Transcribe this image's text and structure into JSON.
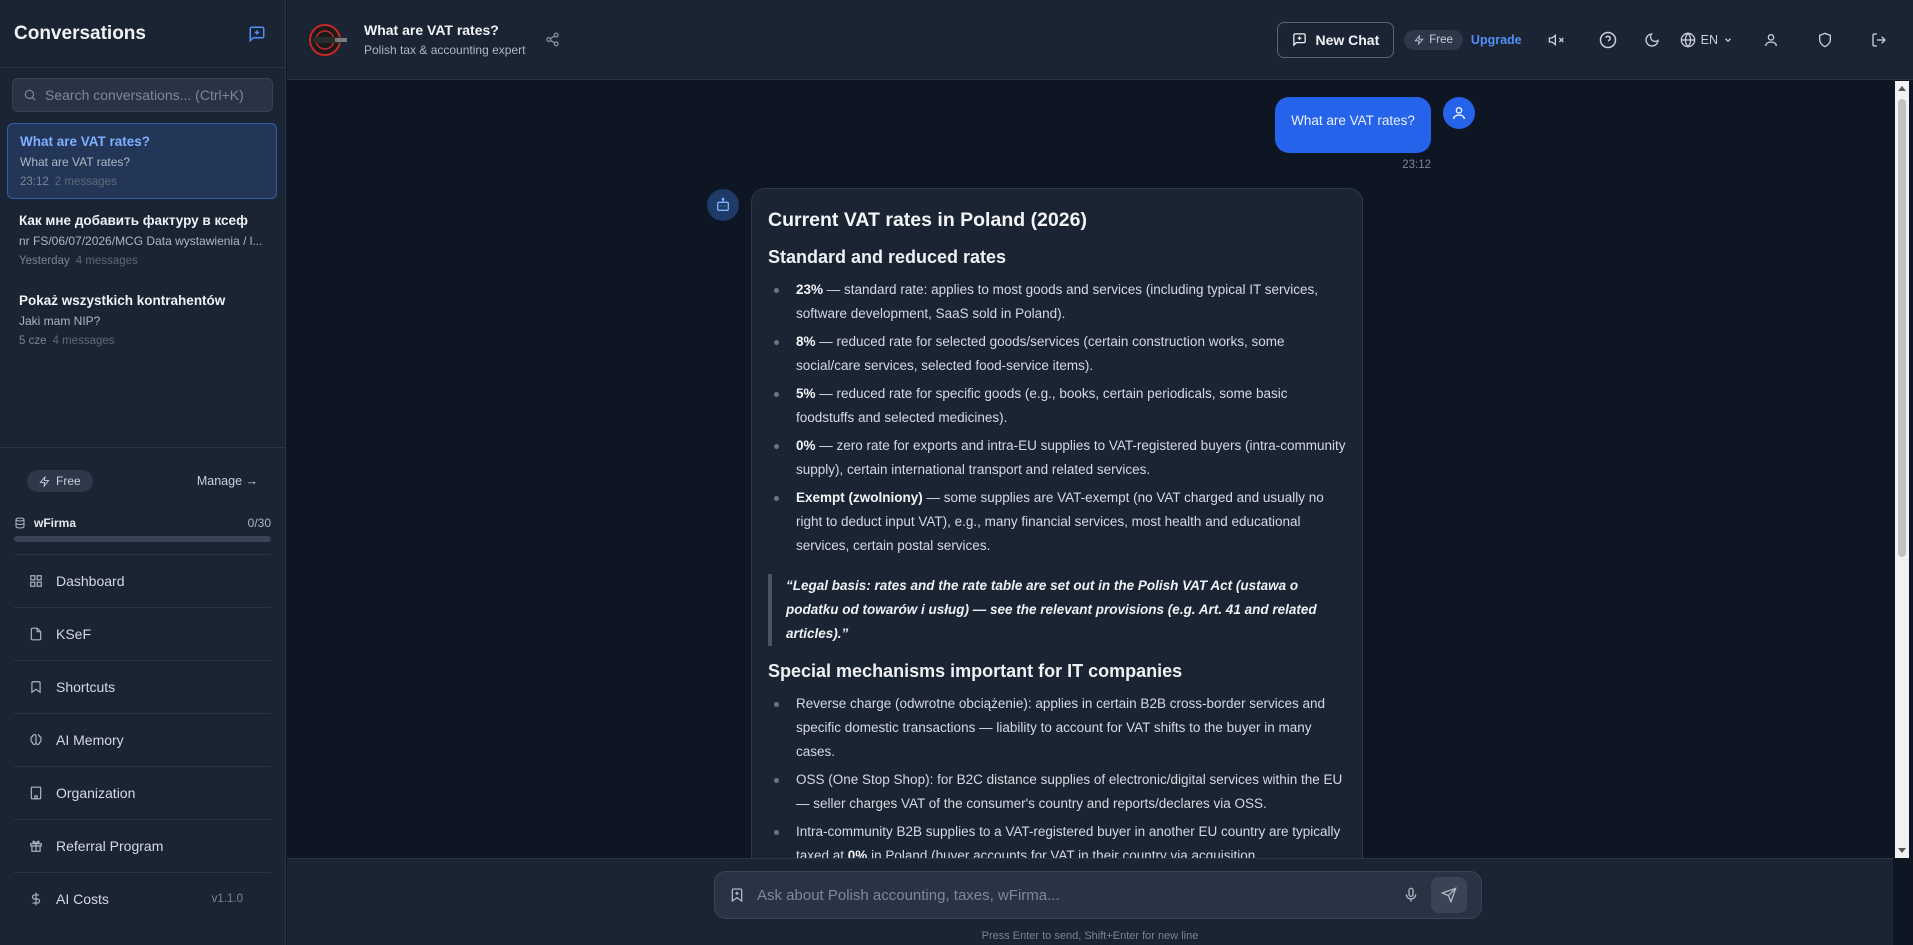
{
  "sidebar": {
    "title": "Conversations",
    "search_placeholder": "Search conversations... (Ctrl+K)",
    "conversations": [
      {
        "title": "What are VAT rates?",
        "preview": "What are VAT rates?",
        "time": "23:12",
        "count": "2 messages",
        "active": true
      },
      {
        "title": "Как мне добавить фактуру в ксеф",
        "preview": "nr FS/06/07/2026/MCG Data wystawienia / l...",
        "time": "Yesterday",
        "count": "4 messages",
        "active": false
      },
      {
        "title": "Pokaż wszystkich kontrahentów",
        "preview": "Jaki mam NIP?",
        "time": "5 cze",
        "count": "4 messages",
        "active": false
      }
    ],
    "plan_label": "Free",
    "manage_label": "Manage →",
    "usage": {
      "name": "wFirma",
      "count": "0/30",
      "fraction": 0.0
    },
    "nav": [
      {
        "label": "Dashboard",
        "icon": "grid-icon"
      },
      {
        "label": "KSeF",
        "icon": "document-icon"
      },
      {
        "label": "Shortcuts",
        "icon": "bookmark-icon"
      },
      {
        "label": "AI Memory",
        "icon": "brain-icon"
      },
      {
        "label": "Organization",
        "icon": "building-icon"
      },
      {
        "label": "Referral Program",
        "icon": "gift-icon"
      }
    ],
    "ai_costs_label": "AI Costs",
    "version": "v1.1.0"
  },
  "topbar": {
    "title": "What are VAT rates?",
    "subtitle": "Polish tax & accounting expert",
    "new_chat_label": "New Chat",
    "plan_label": "Free",
    "upgrade_label": "Upgrade",
    "lang_label": "EN"
  },
  "chat": {
    "user_message": "What are VAT rates?",
    "user_time": "23:12",
    "answer": {
      "title": "Current VAT rates in Poland (2026)",
      "section1_heading": "Standard and reduced rates",
      "rates": [
        {
          "bold": "23%",
          "text": " — standard rate: applies to most goods and services (including typical IT services, software development, SaaS sold in Poland)."
        },
        {
          "bold": "8%",
          "text": " — reduced rate for selected goods/services (certain construction works, some social/care services, selected food-service items)."
        },
        {
          "bold": "5%",
          "text": " — reduced rate for specific goods (e.g., books, certain periodicals, some basic foodstuffs and selected medicines)."
        },
        {
          "bold": "0%",
          "text": " — zero rate for exports and intra-EU supplies to VAT-registered buyers (intra-community supply), certain international transport and related services."
        },
        {
          "bold": "Exempt (zwolniony)",
          "text": " — some supplies are VAT-exempt (no VAT charged and usually no right to deduct input VAT), e.g., many financial services, most health and educational services, certain postal services."
        }
      ],
      "quote": "“Legal basis: rates and the rate table are set out in the Polish VAT Act (ustawa o podatku od towarów i usług) — see the relevant provisions (e.g. Art. 41 and related articles).”",
      "section2_heading": "Special mechanisms important for IT companies",
      "mechanisms": [
        "Reverse charge (odwrotne obciążenie): applies in certain B2B cross-border services and specific domestic transactions — liability to account for VAT shifts to the buyer in many cases.",
        "OSS (One Stop Shop): for B2C distance supplies of electronic/digital services within the EU — seller charges VAT of the consumer's country and reports/declares via OSS."
      ],
      "mechanism3_a": "Intra-community B2B supplies to a VAT-registered buyer in another EU country are typically taxed at ",
      "mechanism3_bold": "0%",
      "mechanism3_b": " in Poland (buyer accounts for VAT in their country via acquisition"
    }
  },
  "composer": {
    "placeholder": "Ask about Polish accounting, taxes, wFirma...",
    "hint": "Press Enter to send, Shift+Enter for new line"
  }
}
